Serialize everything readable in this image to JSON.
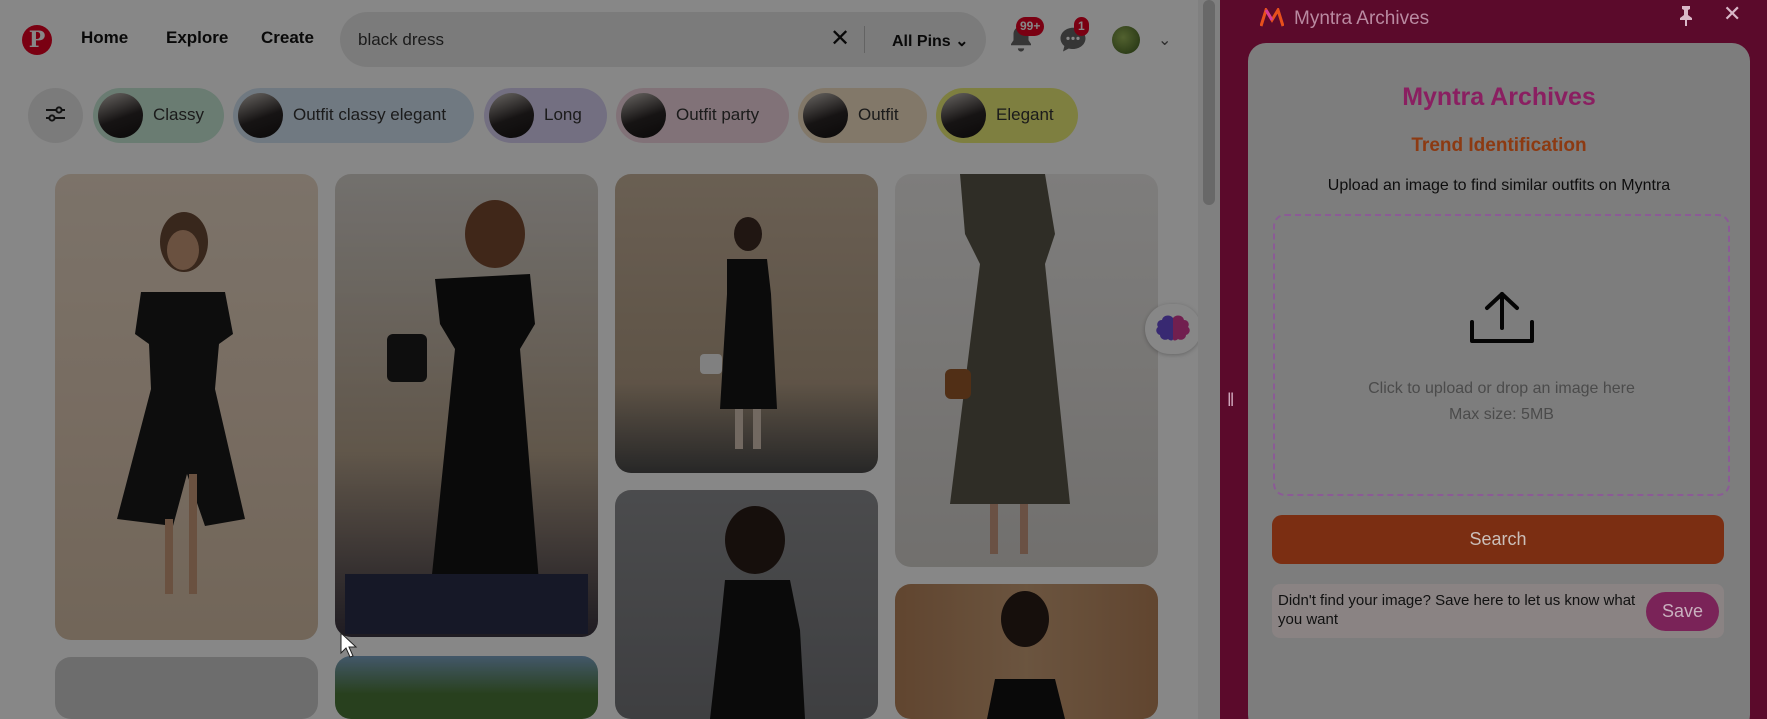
{
  "pinterest": {
    "nav": {
      "home": "Home",
      "explore": "Explore",
      "create": "Create"
    },
    "search": {
      "value": "black dress",
      "scope": "All Pins"
    },
    "notifications_badge": "99+",
    "messages_badge": "1",
    "chips": [
      {
        "label": "Classy",
        "color": "#c8ead8"
      },
      {
        "label": "Outfit classy elegant",
        "color": "#d4e4f4"
      },
      {
        "label": "Long",
        "color": "#d9d2f4"
      },
      {
        "label": "Outfit party",
        "color": "#f3d8e2"
      },
      {
        "label": "Outfit",
        "color": "#f5e3c6"
      },
      {
        "label": "Elegant",
        "color": "#eef07a"
      }
    ]
  },
  "panel": {
    "window_title": "Myntra Archives",
    "heading": "Myntra Archives",
    "subheading": "Trend Identification",
    "description": "Upload an image to find similar outfits on Myntra",
    "upload_text": "Click to upload or drop an image here",
    "upload_max": "Max size: 5MB",
    "search_label": "Search",
    "feedback_text": "Didn't find your image? Save here to let us know what you want",
    "save_label": "Save"
  },
  "colors": {
    "pinterest_red": "#e60023",
    "myntra_pink": "#d63c96",
    "myntra_orange": "#e8501c"
  }
}
